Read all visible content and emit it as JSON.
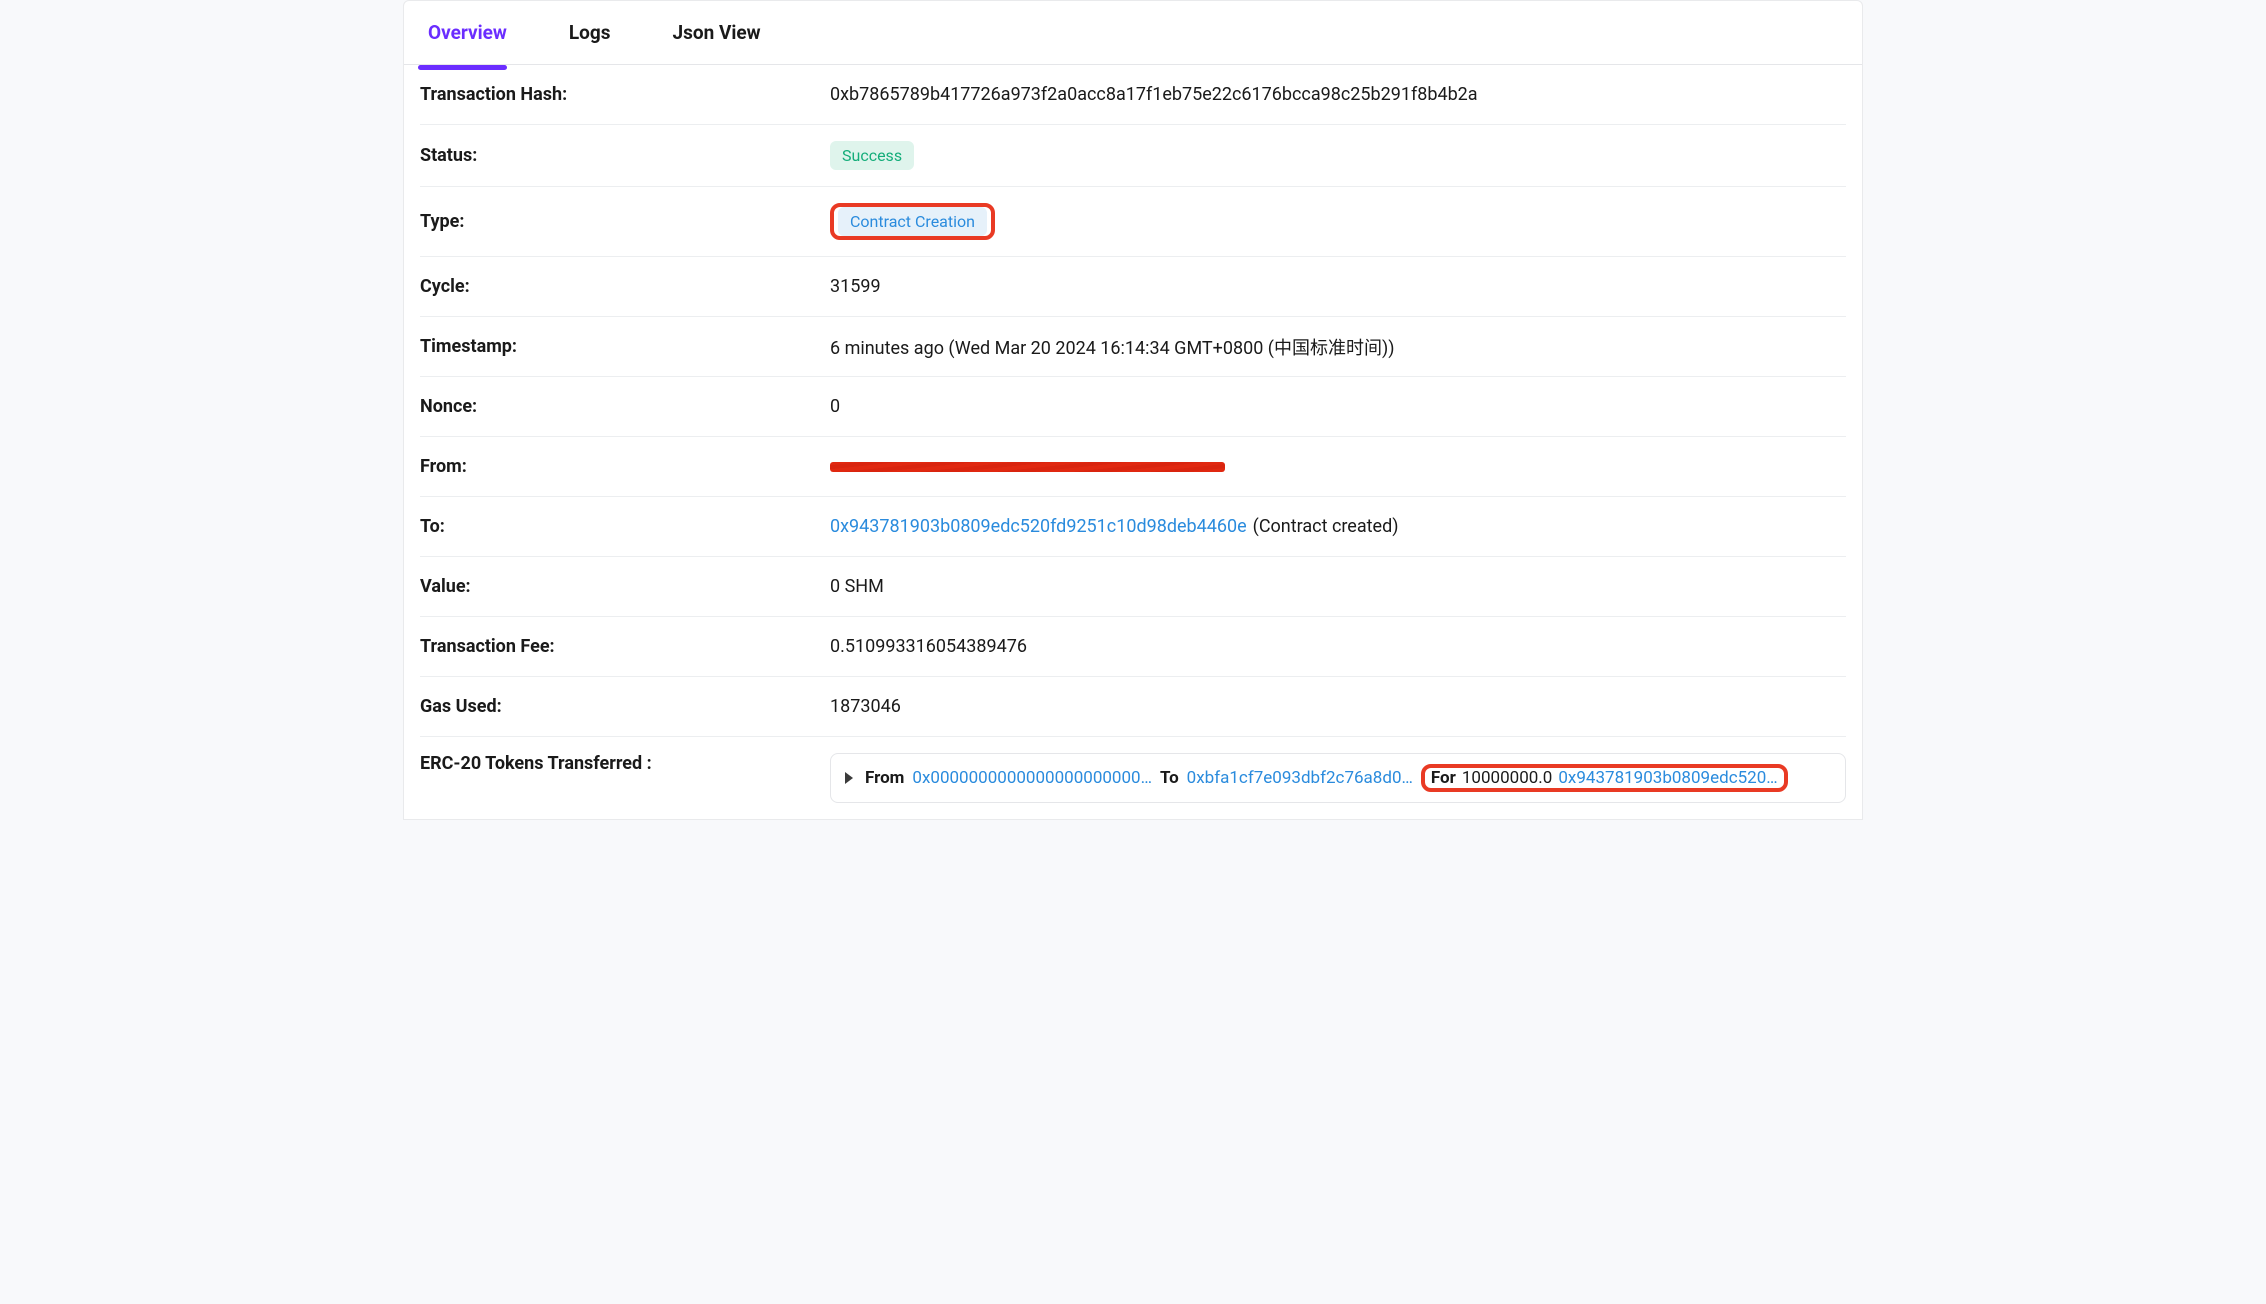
{
  "tabs": {
    "overview": "Overview",
    "logs": "Logs",
    "json": "Json View"
  },
  "fields": {
    "txhash_label": "Transaction Hash:",
    "txhash_value": "0xb7865789b417726a973f2a0acc8a17f1eb75e22c6176bcca98c25b291f8b4b2a",
    "status_label": "Status:",
    "status_value": "Success",
    "type_label": "Type:",
    "type_value": "Contract Creation",
    "cycle_label": "Cycle:",
    "cycle_value": "31599",
    "timestamp_label": "Timestamp:",
    "timestamp_value": "6 minutes ago (Wed Mar 20 2024 16:14:34 GMT+0800 (中国标准时间))",
    "nonce_label": "Nonce:",
    "nonce_value": "0",
    "from_label": "From:",
    "to_label": "To:",
    "to_address": "0x943781903b0809edc520fd9251c10d98deb4460e",
    "to_note": " (Contract created)",
    "value_label": "Value:",
    "value_value": "0 SHM",
    "fee_label": "Transaction Fee:",
    "fee_value": "0.510993316054389476",
    "gas_label": "Gas Used:",
    "gas_value": "1873046",
    "erc20_label": "ERC-20 Tokens Transferred :"
  },
  "transfer": {
    "from_label": "From",
    "from_addr": "0x0000000000000000000000…",
    "to_label": "To",
    "to_addr": "0xbfa1cf7e093dbf2c76a8d0…",
    "for_label": "For",
    "for_amount": "10000000.0",
    "for_addr": "0x943781903b0809edc520…"
  }
}
